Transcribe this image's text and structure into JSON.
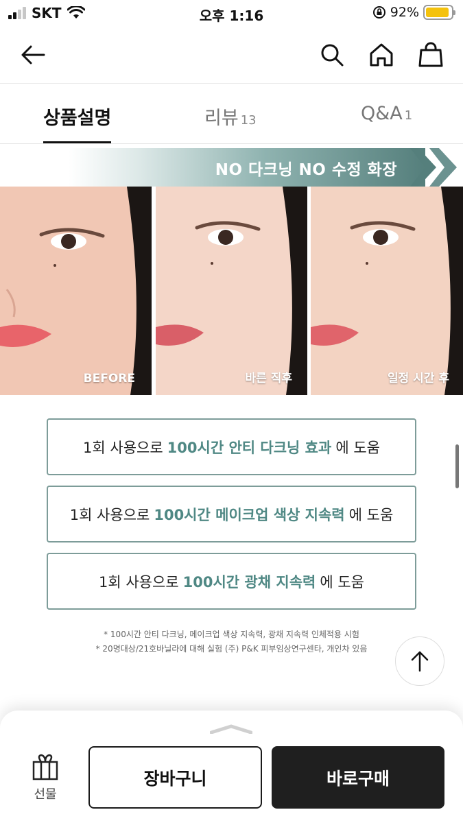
{
  "status_bar": {
    "carrier": "SKT",
    "time": "오후 1:16",
    "battery_percent": "92%",
    "battery_level": 0.92,
    "battery_color": "#f4c20d"
  },
  "header": {
    "icons": [
      "back-arrow-icon",
      "search-icon",
      "home-icon",
      "shopping-bag-icon"
    ]
  },
  "tabs": [
    {
      "label": "상품설명",
      "count": "",
      "active": true
    },
    {
      "label": "리뷰",
      "count": "13",
      "active": false
    },
    {
      "label": "Q&A",
      "count": "1",
      "active": false
    }
  ],
  "banner": {
    "text": "NO 다크닝 NO 수정 화장"
  },
  "photos": [
    {
      "caption": "BEFORE"
    },
    {
      "caption": "바른 직후"
    },
    {
      "caption": "일정 시간 후"
    }
  ],
  "claims": [
    {
      "prefix": "1회 사용으로",
      "highlight": "100시간 안티 다크닝 효과",
      "suffix": "에 도움"
    },
    {
      "prefix": "1회 사용으로",
      "highlight": "100시간 메이크업 색상 지속력",
      "suffix": "에 도움"
    },
    {
      "prefix": "1회 사용으로",
      "highlight": "100시간 광채 지속력",
      "suffix": "에 도움"
    }
  ],
  "footnotes": [
    "* 100시간 안티 다크닝, 메이크업 색상 지속력, 광채 지속력 인체적용 시험",
    "* 20명대상/21호바닐라에 대해 실험 (주) P&K 피부임상연구센타, 개인차 있음"
  ],
  "bottom_bar": {
    "gift_label": "선물",
    "cart_label": "장바구니",
    "buy_label": "바로구매"
  },
  "colors": {
    "accent": "#4f8884",
    "claim_border": "#7d9c99",
    "buy_button": "#1f1f1f"
  }
}
